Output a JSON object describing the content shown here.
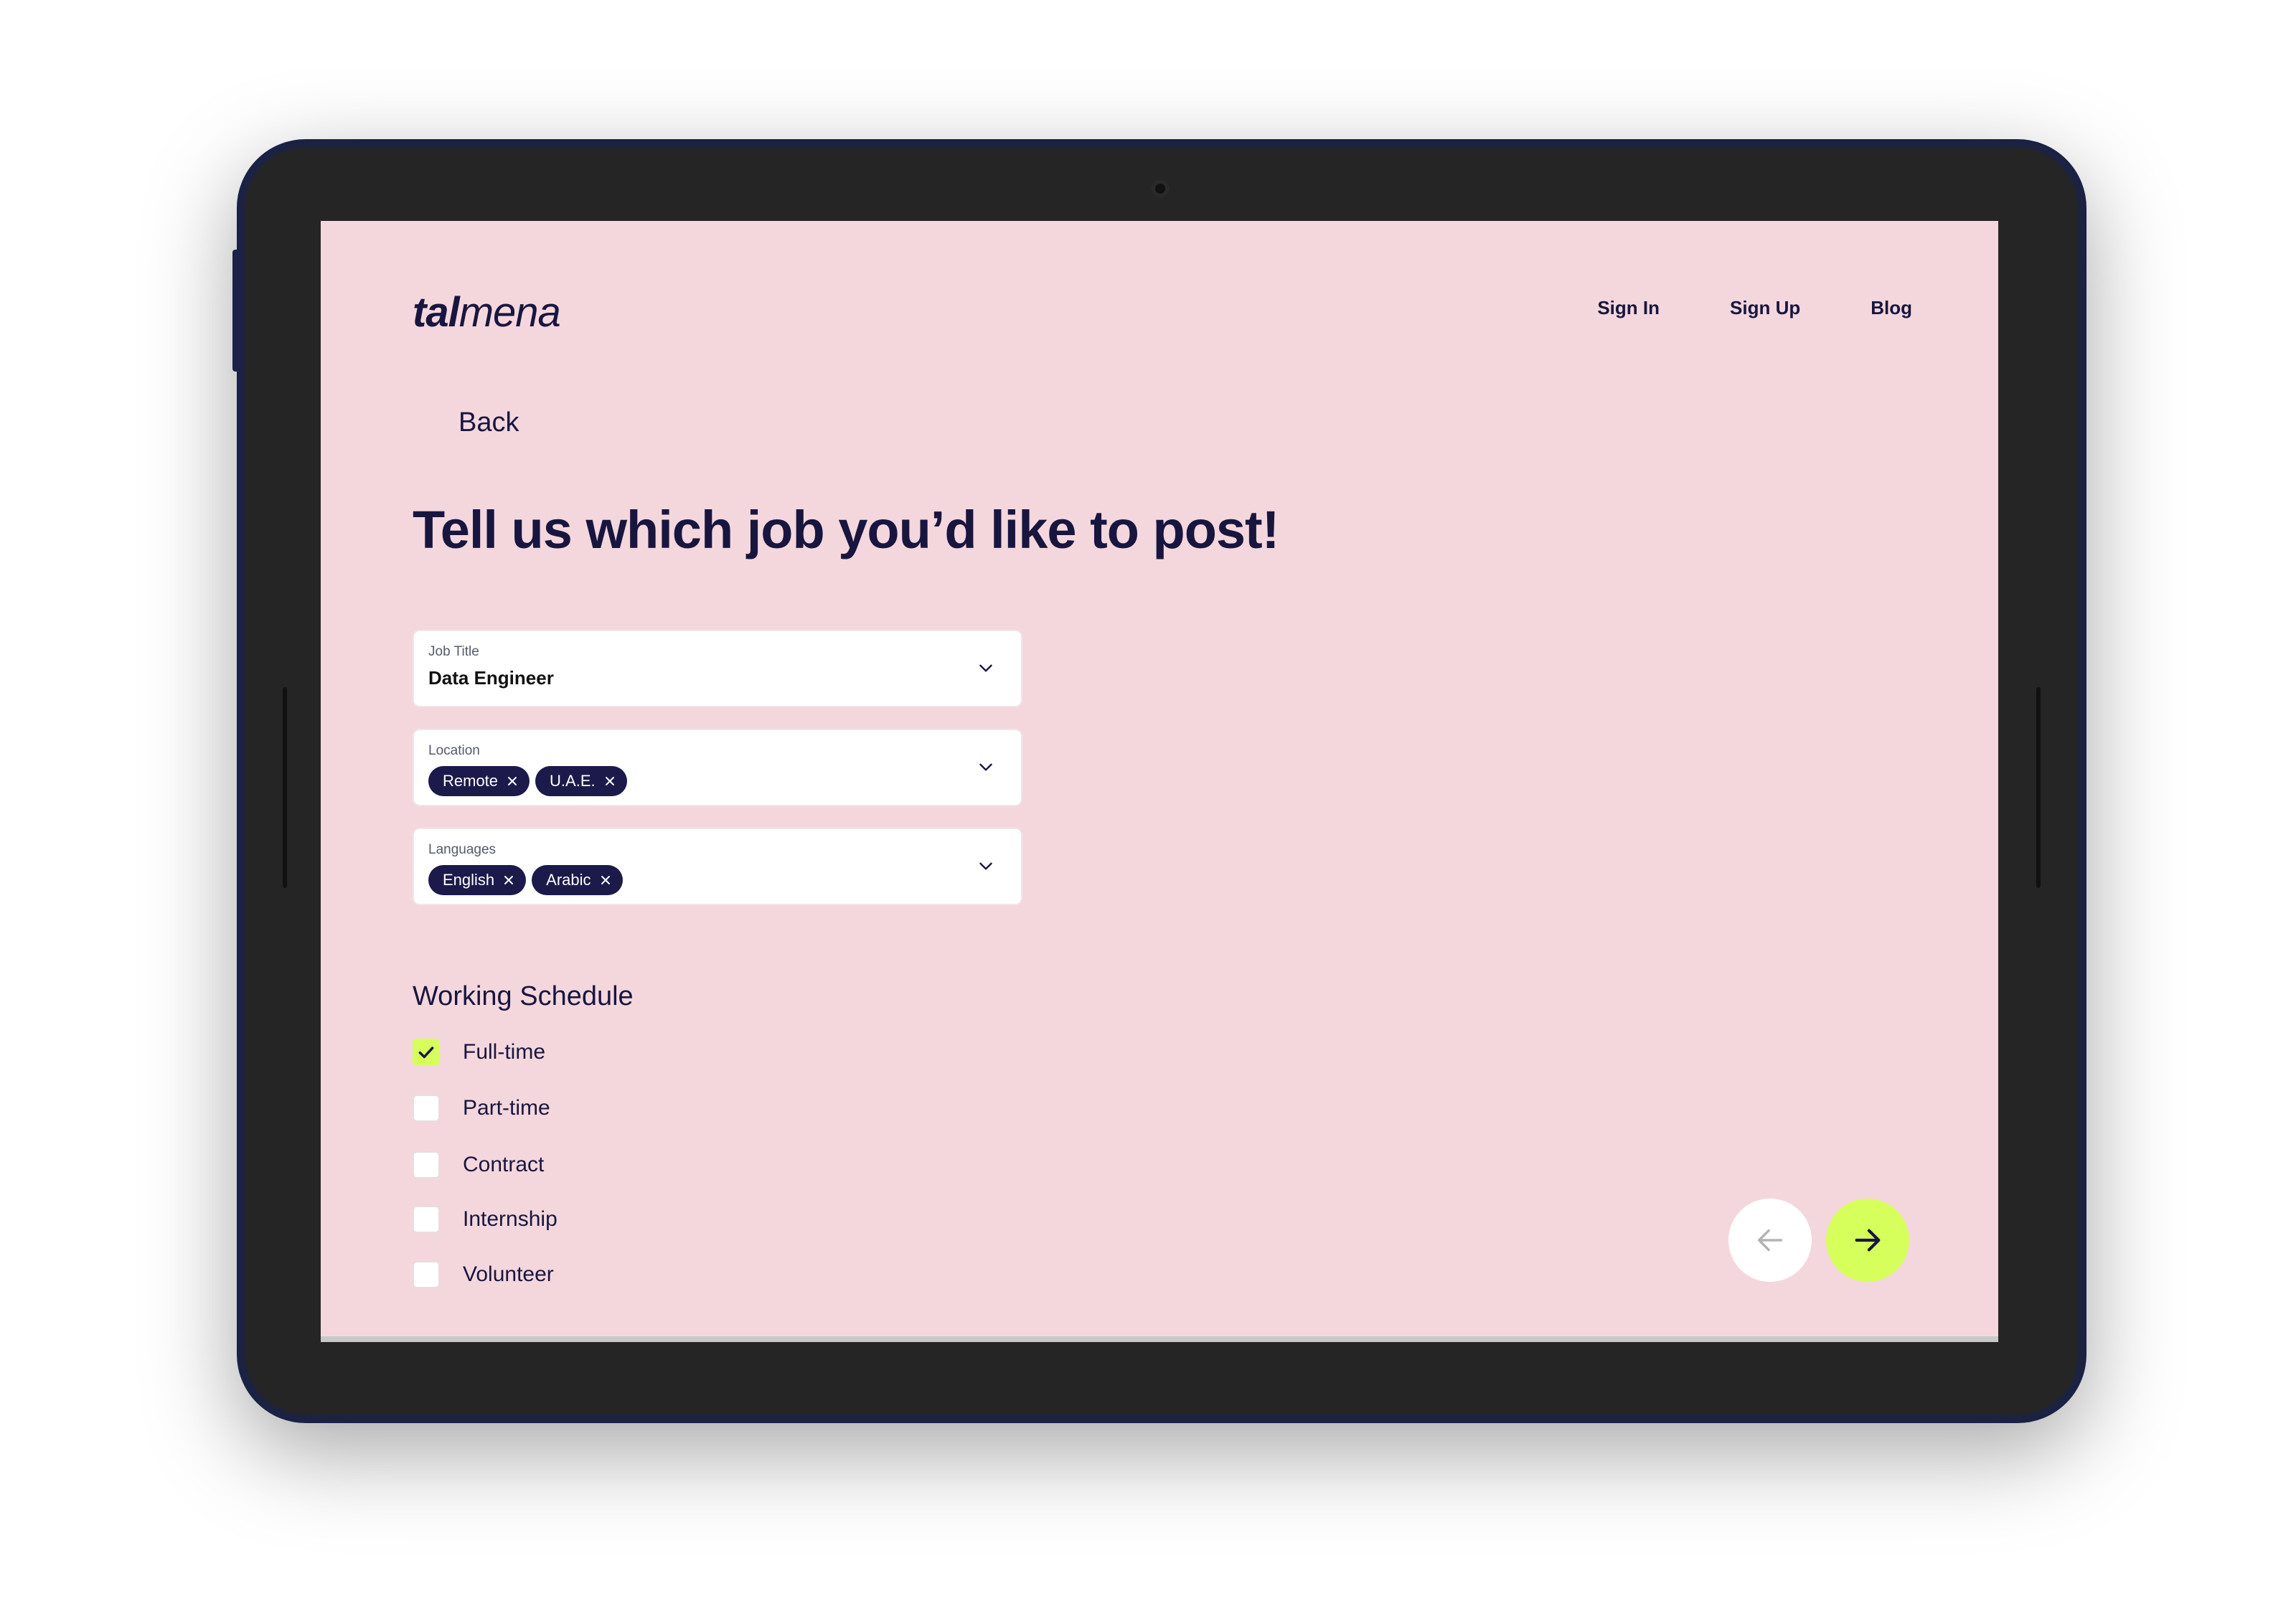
{
  "brand": {
    "logo_bold": "tal",
    "logo_light": "mena"
  },
  "nav": {
    "items": [
      "Sign In",
      "Sign Up",
      "Blog"
    ]
  },
  "back_label": "Back",
  "headline": "Tell us which job you’d like to post!",
  "form": {
    "job_title": {
      "label": "Job Title",
      "value": "Data Engineer"
    },
    "location": {
      "label": "Location",
      "chips": [
        "Remote",
        "U.A.E."
      ]
    },
    "languages": {
      "label": "Languages",
      "chips": [
        "English",
        "Arabic"
      ]
    }
  },
  "schedule": {
    "title": "Working Schedule",
    "options": [
      {
        "label": "Full-time",
        "checked": true
      },
      {
        "label": "Part-time",
        "checked": false
      },
      {
        "label": "Contract",
        "checked": false
      },
      {
        "label": "Internship",
        "checked": false
      },
      {
        "label": "Volunteer",
        "checked": false
      }
    ]
  },
  "colors": {
    "screen_bg": "#f4d7dd",
    "ink": "#18163f",
    "chip_bg": "#1b1a4a",
    "accent": "#d6ff5c"
  },
  "icons": {
    "chevron": "chevron-down-icon",
    "chip_remove": "close-icon",
    "check": "check-icon",
    "prev": "arrow-left-icon",
    "next": "arrow-right-icon"
  }
}
